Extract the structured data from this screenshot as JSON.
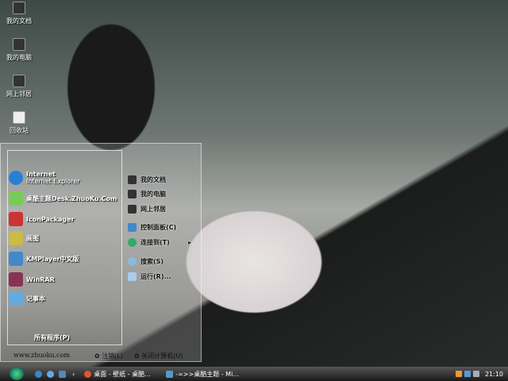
{
  "desktop": {
    "icons": [
      {
        "label": "我的文档"
      },
      {
        "label": "我的电脑"
      },
      {
        "label": "网上邻居"
      },
      {
        "label": "回收站"
      }
    ]
  },
  "start_menu": {
    "pinned": [
      {
        "title": "Internet",
        "subtitle": "Internet Explorer",
        "color": "#2a7fd4"
      },
      {
        "title": "桌酷主题Desk.ZhuoKu.Com",
        "color": "#7c5"
      },
      {
        "title": "IconPackager",
        "color": "#c33"
      },
      {
        "title": "画图",
        "color": "#cb4"
      },
      {
        "title": "KMPlayer中文版",
        "color": "#48c"
      },
      {
        "title": "WinRAR",
        "color": "#835"
      },
      {
        "title": "记事本",
        "color": "#6ad"
      }
    ],
    "all_programs": "所有程序(P)",
    "places": [
      {
        "label": "我的文档"
      },
      {
        "label": "我的电脑"
      },
      {
        "label": "网上邻居"
      },
      {
        "label": "控制面板(C)"
      },
      {
        "label": "连接到(T)",
        "submenu_arrow": "▸"
      },
      {
        "label": "搜索(S)"
      },
      {
        "label": "运行(R)..."
      }
    ],
    "footer": {
      "url": "www.zhuoku.com",
      "logoff": "注销(L)",
      "shutdown": "关闭计算机(U)"
    }
  },
  "taskbar": {
    "tasks": [
      {
        "label": "桌面 - 壁纸 - 桌酷..."
      },
      {
        "label": "-=>>桌酷主题 - Mi..."
      }
    ],
    "expand": "›",
    "clock": "21:10"
  }
}
